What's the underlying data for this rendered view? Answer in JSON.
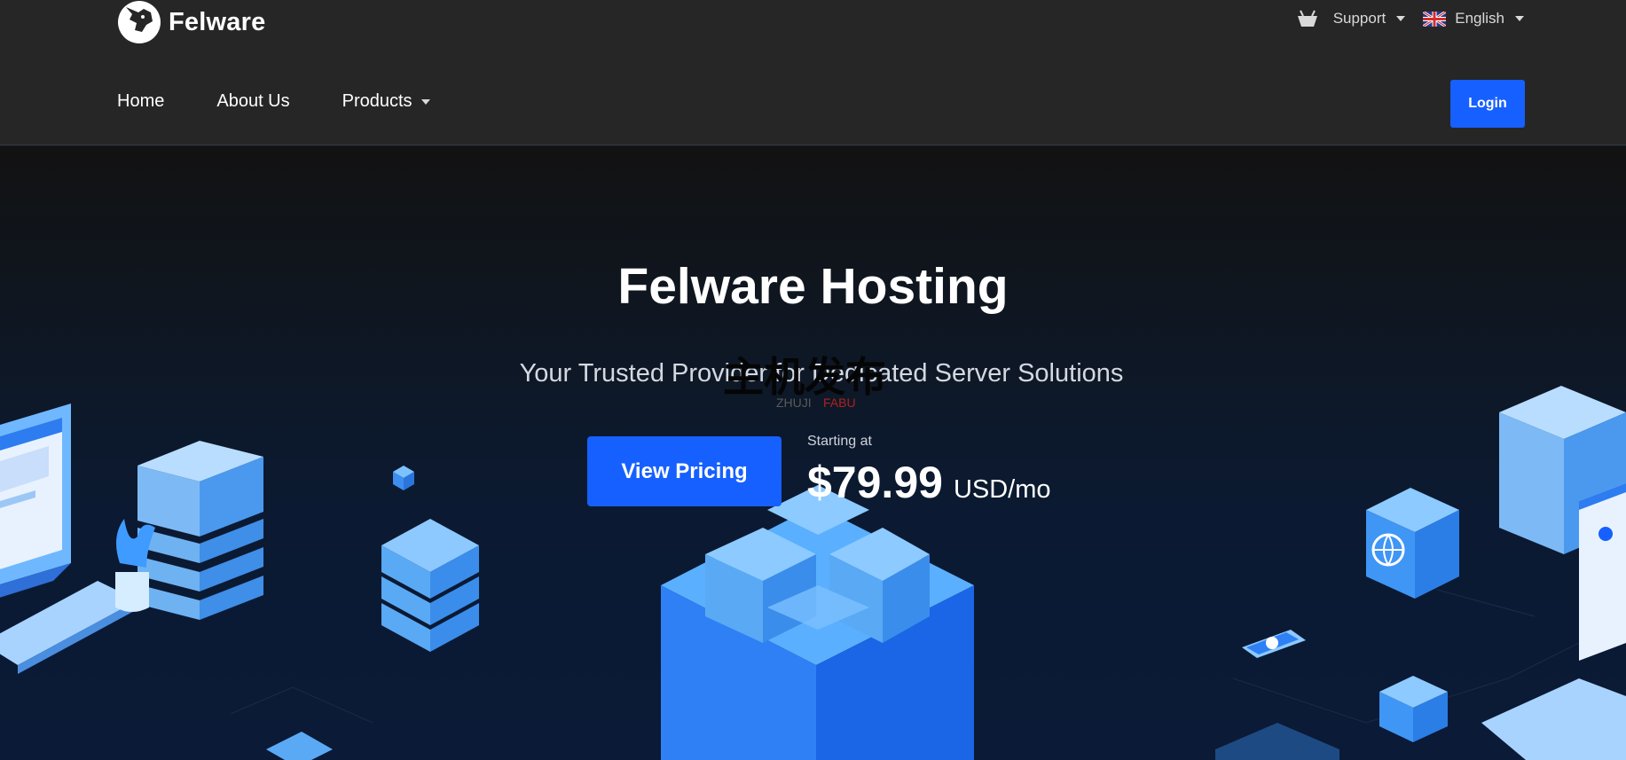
{
  "brand": {
    "name": "Felware",
    "logo_icon": "dog-head-logo-icon"
  },
  "util_nav": {
    "cart_icon": "basket-icon",
    "support_label": "Support",
    "language_label": "English",
    "language_flag": "uk-flag-icon"
  },
  "nav": {
    "home": "Home",
    "about": "About Us",
    "products": "Products"
  },
  "login_label": "Login",
  "hero": {
    "title": "Felware Hosting",
    "subtitle": "Your Trusted Provider for Dedicated Server Solutions",
    "cta_label": "View Pricing",
    "starting_label": "Starting at",
    "price": "$79.99",
    "price_unit": "USD/mo"
  },
  "watermark": {
    "main": "主机发布",
    "sub_left": "ZHUJI",
    "sub_right": "FABU"
  },
  "colors": {
    "accent": "#1660ff",
    "header_bg": "#262626",
    "hero_bottom": "#0b1a36",
    "illustration_blue": "#4aa8ff"
  }
}
